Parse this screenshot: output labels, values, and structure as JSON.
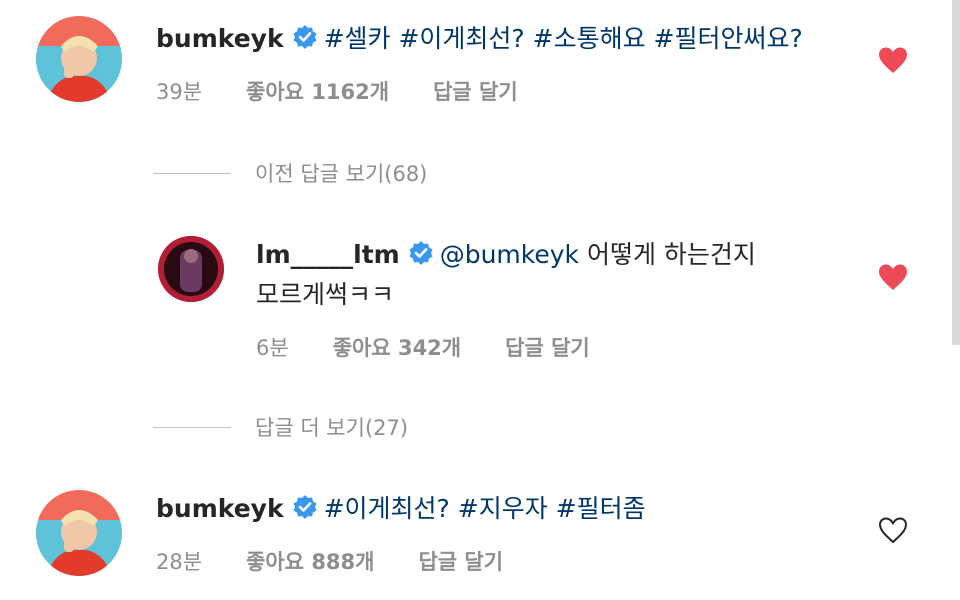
{
  "comments": [
    {
      "username": "bumkeyk",
      "text": "#셀카 #이게최선? #소통해요 #필터안써요?",
      "time": "39분",
      "likes": "좋아요 1162개",
      "reply": "답글 달기",
      "liked": true
    },
    {
      "username": "lm_____ltm",
      "mention": "@bumkeyk",
      "text_line1": " 어떻게 하는건지",
      "text_line2": "모르게썩ㅋㅋ",
      "time": "6분",
      "likes": "좋아요 342개",
      "reply": "답글 달기",
      "liked": true
    },
    {
      "username": "bumkeyk",
      "text": "#이게최선? #지우자 #필터좀",
      "time": "28분",
      "likes": "좋아요 888개",
      "reply": "답글 달기",
      "liked": false
    }
  ],
  "view_previous_replies": "이전 답글 보기(68)",
  "view_more_replies": "답글 더 보기(27)",
  "colors": {
    "heart": "#ed4956",
    "verified": "#3897f0",
    "hashtag": "#00376b",
    "meta": "#8e8e8e"
  }
}
